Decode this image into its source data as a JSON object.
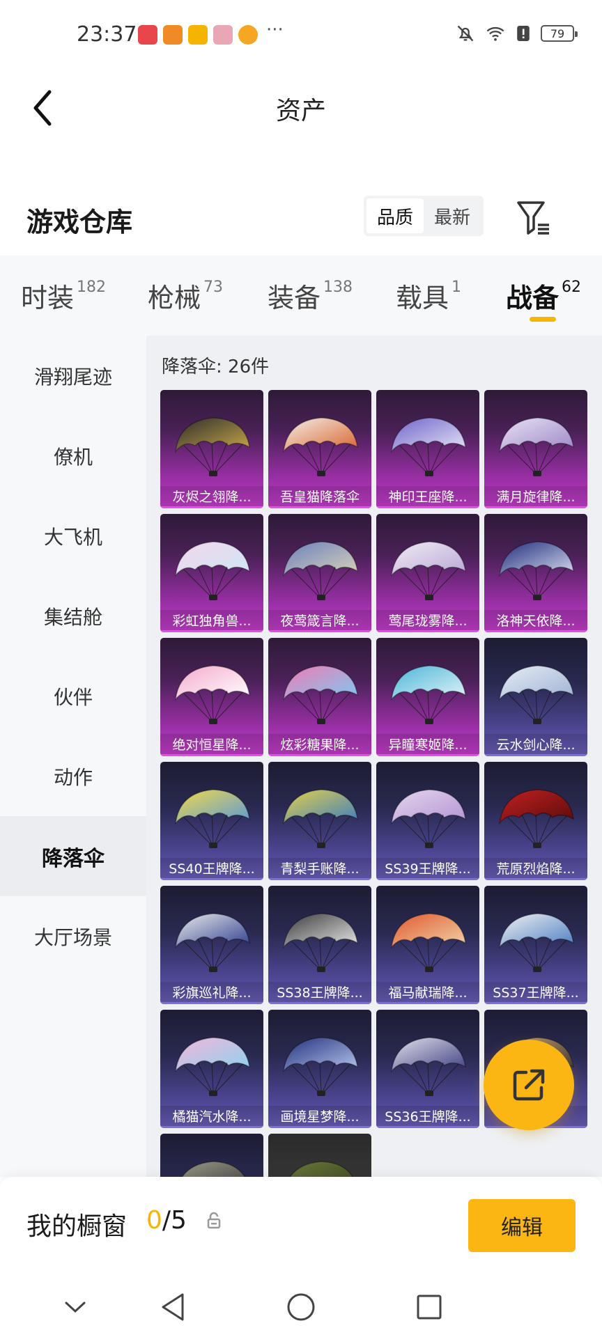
{
  "status_bar": {
    "time": "23:37",
    "battery": "79",
    "more": "···",
    "notification_icons": [
      {
        "name": "app-notification-icon-1",
        "color": "#e8464b"
      },
      {
        "name": "app-notification-icon-2",
        "color": "#f08a24"
      },
      {
        "name": "app-notification-icon-3",
        "color": "#f5b400"
      },
      {
        "name": "app-notification-icon-4",
        "color": "#e9a7b5"
      },
      {
        "name": "app-notification-icon-5",
        "color": "#f5a623"
      }
    ]
  },
  "header": {
    "title": "资产",
    "back_icon": "chevron-left-icon"
  },
  "section": {
    "title": "游戏仓库",
    "sort_options": [
      "品质",
      "最新"
    ],
    "sort_selected": "品质",
    "filter_icon": "filter-icon"
  },
  "tabs": [
    {
      "label": "时装",
      "count": "182",
      "active": false
    },
    {
      "label": "枪械",
      "count": "73",
      "active": false
    },
    {
      "label": "装备",
      "count": "138",
      "active": false
    },
    {
      "label": "载具",
      "count": "1",
      "active": false
    },
    {
      "label": "战备",
      "count": "62",
      "active": true
    }
  ],
  "sidebar": {
    "items": [
      {
        "label": "滑翔尾迹",
        "active": false
      },
      {
        "label": "僚机",
        "active": false
      },
      {
        "label": "大飞机",
        "active": false
      },
      {
        "label": "集结舱",
        "active": false
      },
      {
        "label": "伙伴",
        "active": false
      },
      {
        "label": "动作",
        "active": false
      },
      {
        "label": "降落伞",
        "active": true
      },
      {
        "label": "大厅场景",
        "active": false
      }
    ]
  },
  "content": {
    "count_label": "降落伞: 26件",
    "items": [
      {
        "name": "灰烬之翎降...",
        "rarity": "purple",
        "colors": [
          "#2b2b2b",
          "#c9a84a"
        ]
      },
      {
        "name": "吾皇猫降落伞",
        "rarity": "purple",
        "colors": [
          "#f4efe9",
          "#d9642e"
        ]
      },
      {
        "name": "神印王座降...",
        "rarity": "purple",
        "colors": [
          "#6d64c9",
          "#e6e3f7"
        ]
      },
      {
        "name": "满月旋律降...",
        "rarity": "purple",
        "colors": [
          "#e9e3f4",
          "#9c86c9"
        ]
      },
      {
        "name": "彩虹独角兽...",
        "rarity": "purple",
        "colors": [
          "#f3d7ec",
          "#cfe6f4"
        ]
      },
      {
        "name": "夜莺箴言降...",
        "rarity": "purple",
        "colors": [
          "#6b7fbf",
          "#d9d3b8"
        ]
      },
      {
        "name": "莺尾珑雾降...",
        "rarity": "purple",
        "colors": [
          "#f1ecf5",
          "#b8a8d6"
        ]
      },
      {
        "name": "洛神天依降...",
        "rarity": "purple",
        "colors": [
          "#1e2c7a",
          "#d7dbef"
        ]
      },
      {
        "name": "绝对恒星降...",
        "rarity": "purple",
        "colors": [
          "#f4a9cc",
          "#ffffff"
        ]
      },
      {
        "name": "炫彩糖果降...",
        "rarity": "purple",
        "colors": [
          "#f07ab5",
          "#7ec9ef"
        ]
      },
      {
        "name": "异瞳寒姬降...",
        "rarity": "purple",
        "colors": [
          "#4ab6d8",
          "#e3f2f8"
        ]
      },
      {
        "name": "云水剑心降...",
        "rarity": "blue",
        "colors": [
          "#e6ecf4",
          "#9fb3d3"
        ]
      },
      {
        "name": "SS40王牌降...",
        "rarity": "blue",
        "colors": [
          "#f3d94a",
          "#5a9ad8"
        ]
      },
      {
        "name": "青梨手账降...",
        "rarity": "blue",
        "colors": [
          "#e6d04a",
          "#3e7fbf"
        ]
      },
      {
        "name": "SS39王牌降...",
        "rarity": "blue",
        "colors": [
          "#e3d6ef",
          "#b593d3"
        ]
      },
      {
        "name": "荒原烈焰降...",
        "rarity": "blue",
        "colors": [
          "#c32020",
          "#5a0c0c"
        ]
      },
      {
        "name": "彩旗巡礼降...",
        "rarity": "blue",
        "colors": [
          "#ececec",
          "#2f3f8f"
        ]
      },
      {
        "name": "SS38王牌降...",
        "rarity": "blue",
        "colors": [
          "#3a3a3a",
          "#e8e8e8"
        ]
      },
      {
        "name": "福马献瑞降...",
        "rarity": "blue",
        "colors": [
          "#e0582e",
          "#f2d2a8"
        ]
      },
      {
        "name": "SS37王牌降...",
        "rarity": "blue",
        "colors": [
          "#f1f1f1",
          "#4d7fc4"
        ]
      },
      {
        "name": "橘猫汽水降...",
        "rarity": "blue",
        "colors": [
          "#f3b6d9",
          "#8ed2ef"
        ]
      },
      {
        "name": "画境星梦降...",
        "rarity": "blue",
        "colors": [
          "#22307a",
          "#b5c6ef"
        ]
      },
      {
        "name": "SS36王牌降...",
        "rarity": "blue",
        "colors": [
          "#e4e2ec",
          "#3d3f83"
        ]
      },
      {
        "name": "",
        "rarity": "blue",
        "colors": [
          "#c6a076",
          "#333333"
        ]
      },
      {
        "name": "",
        "rarity": "blue",
        "colors": [
          "#9a9a88",
          "#3c3c3c"
        ]
      },
      {
        "name": "",
        "rarity": "grey",
        "colors": [
          "#6a7a3a",
          "#3a4020"
        ]
      }
    ]
  },
  "share_fab": {
    "icon": "share-external-icon",
    "color": "#fbb614"
  },
  "showcase": {
    "label": "我的橱窗",
    "current": "0",
    "total": "/5",
    "lock_icon": "lock-icon",
    "edit_label": "编辑"
  },
  "nav": {
    "buttons": [
      "chevron-down-icon",
      "back-triangle-icon",
      "home-circle-icon",
      "recents-square-icon"
    ]
  }
}
